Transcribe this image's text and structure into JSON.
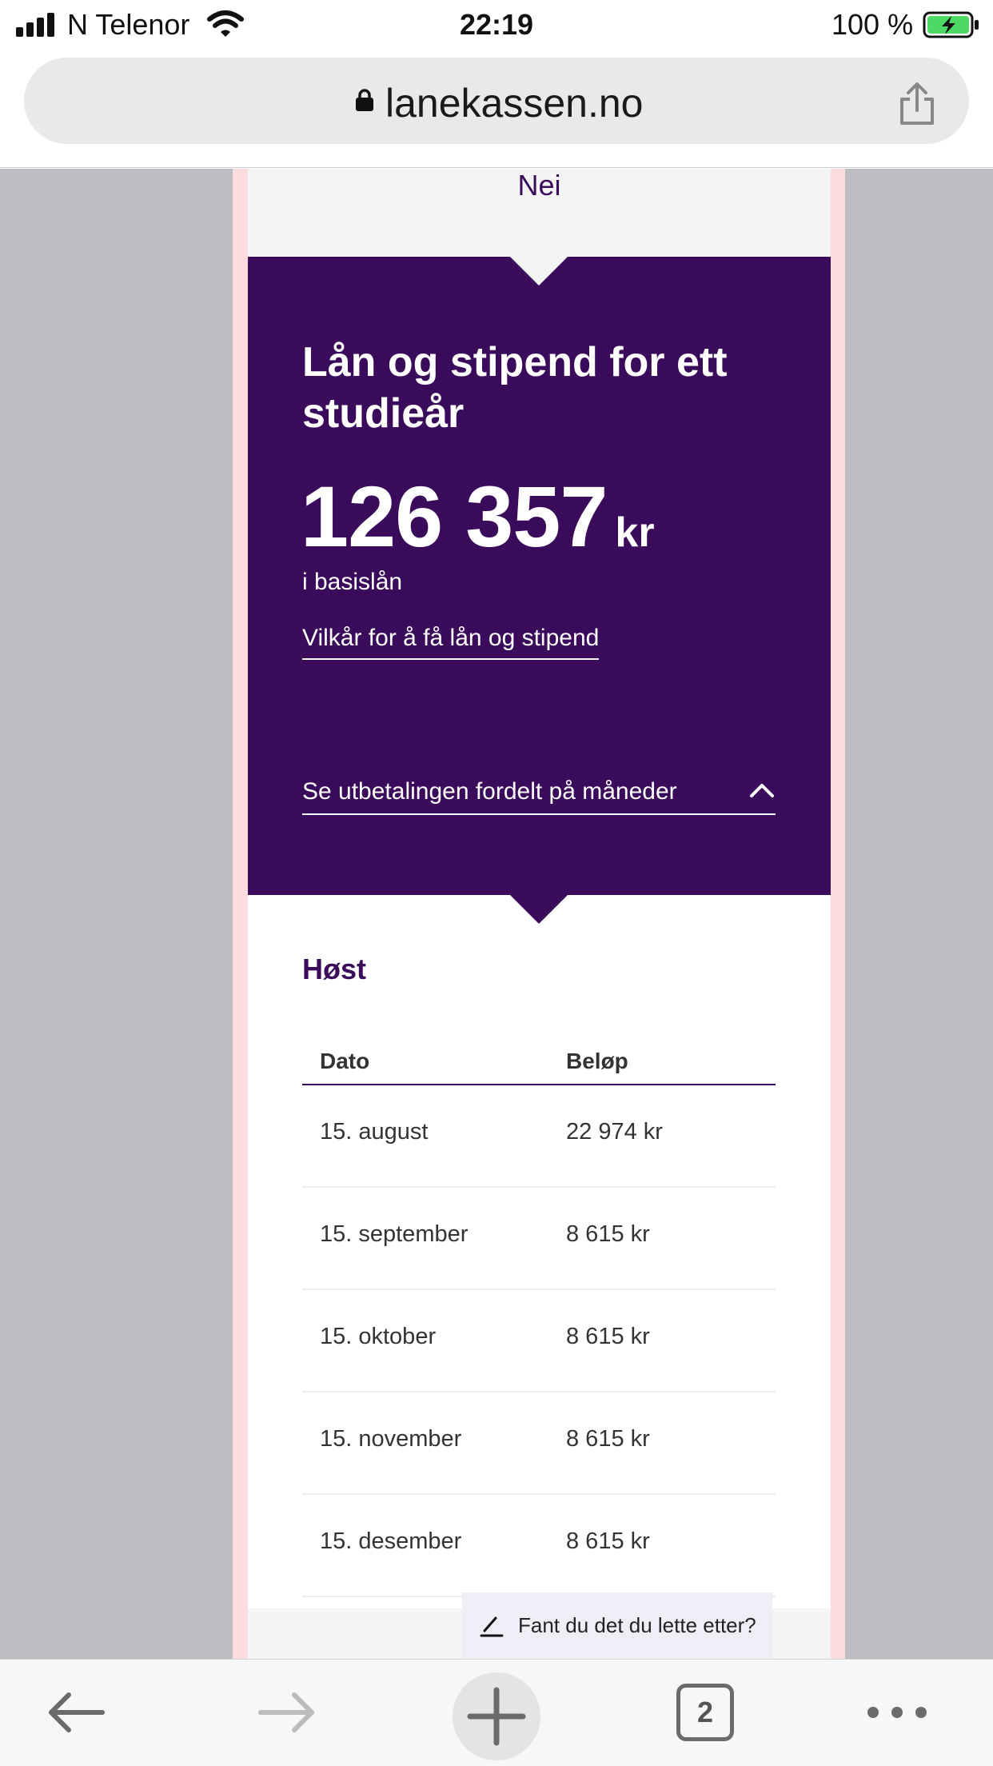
{
  "status_bar": {
    "carrier": "N Telenor",
    "time": "22:19",
    "battery_percent": "100 %"
  },
  "browser": {
    "url": "lanekassen.no",
    "tab_count": "2"
  },
  "page": {
    "previous_answer": "Nei",
    "result": {
      "title": "Lån og stipend for ett studieår",
      "amount": "126 357",
      "unit": "kr",
      "sub": "i basislån",
      "terms_link": "Vilkår for å få lån og stipend",
      "expand_label": "Se utbetalingen fordelt på måneder"
    },
    "schedule": {
      "season": "Høst",
      "columns": [
        "Dato",
        "Beløp"
      ],
      "rows": [
        {
          "date": "15. august",
          "amount": "22 974 kr"
        },
        {
          "date": "15. september",
          "amount": "8 615 kr"
        },
        {
          "date": "15. oktober",
          "amount": "8 615 kr"
        },
        {
          "date": "15. november",
          "amount": "8 615 kr"
        },
        {
          "date": "15. desember",
          "amount": "8 615 kr"
        }
      ]
    },
    "feedback": "Fant du det du lette etter?"
  },
  "colors": {
    "brand_purple": "#3b0b5b",
    "page_background": "#f4f4f4",
    "side_background": "#bdbcc2"
  },
  "icons": [
    "signal-icon",
    "wifi-icon",
    "battery-charging-icon",
    "lock-icon",
    "share-icon",
    "chevron-up-icon",
    "pencil-icon",
    "back-arrow-icon",
    "forward-arrow-icon",
    "plus-icon",
    "more-icon"
  ]
}
